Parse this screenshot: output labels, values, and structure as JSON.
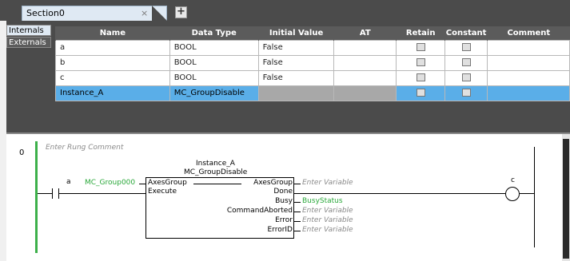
{
  "tabs": {
    "section_label": "Section0",
    "close_glyph": "×",
    "add_glyph": "+"
  },
  "side_tabs": [
    "Internals",
    "Externals"
  ],
  "table": {
    "headers": [
      "Name",
      "Data Type",
      "Initial Value",
      "AT",
      "Retain",
      "Constant",
      "Comment"
    ],
    "rows": [
      {
        "name": "a",
        "type": "BOOL",
        "initial": "False"
      },
      {
        "name": "b",
        "type": "BOOL",
        "initial": "False"
      },
      {
        "name": "c",
        "type": "BOOL",
        "initial": "False"
      },
      {
        "name": "Instance_A",
        "type": "MC_GroupDisable",
        "initial": ""
      }
    ]
  },
  "ladder": {
    "rung_number": "0",
    "comment": "Enter Rung Comment",
    "contact_label": "a",
    "axes_group_input": "MC_Group000",
    "instance_name": "Instance_A",
    "fb_type": "MC_GroupDisable",
    "in_pins": [
      "AxesGroup",
      "Execute"
    ],
    "out_pins": [
      "AxesGroup",
      "Done",
      "Busy",
      "CommandAborted",
      "Error",
      "ErrorID"
    ],
    "out_vars": [
      "Enter Variable",
      "",
      "BusyStatus",
      "Enter Variable",
      "Enter Variable",
      "Enter Variable"
    ],
    "coil_label": "c"
  }
}
